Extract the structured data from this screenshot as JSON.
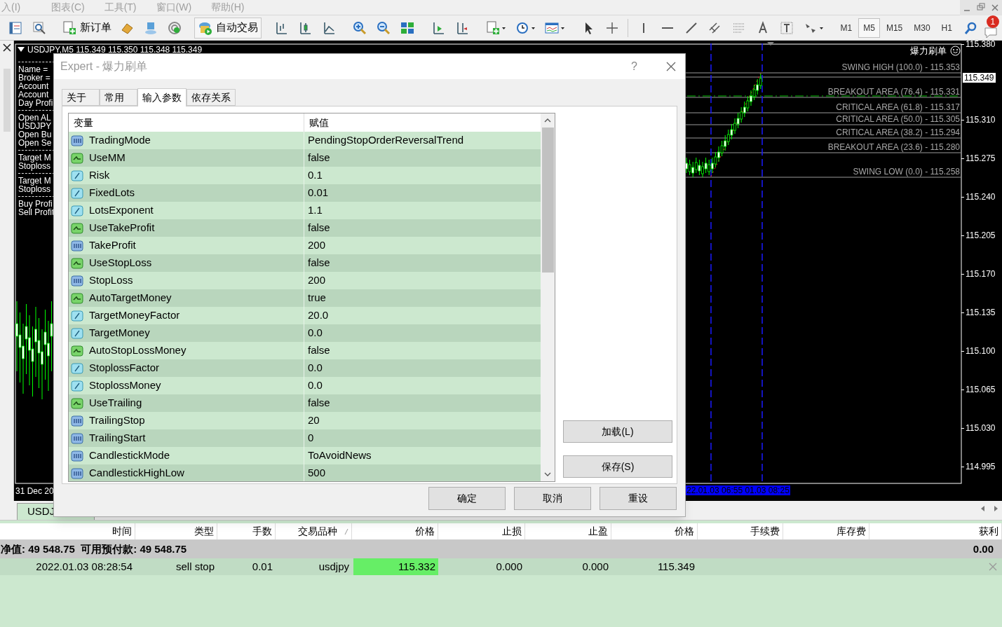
{
  "menu_bar": {
    "items": [
      "入(I)",
      "图表(C)",
      "工具(T)",
      "窗口(W)",
      "帮助(H)"
    ]
  },
  "toolbar": {
    "buttons": [
      {
        "kind": "new_order",
        "label": "新订单"
      },
      {
        "kind": "autotrading",
        "label": "自动交易"
      }
    ],
    "timeframes": [
      {
        "label": "M1",
        "selected": false
      },
      {
        "label": "M5",
        "selected": true
      },
      {
        "label": "M15",
        "selected": false
      },
      {
        "label": "M30",
        "selected": false
      },
      {
        "label": "H1",
        "selected": false
      }
    ],
    "notification_count": "1"
  },
  "chart": {
    "title": "USDJPY,M5  115.349 115.350 115.348 115.349",
    "indicator_name": "爆力刷单",
    "info_groups": [
      [
        "Name =",
        "Broker =",
        "Account",
        "Account",
        "Day Profi"
      ],
      [
        "Open AL",
        "USDJPY",
        "Open Bu",
        "Open Se"
      ],
      [
        "Target M",
        "Stoploss"
      ],
      [
        "Target M",
        "Stoploss"
      ],
      [
        "Buy Profi",
        "Sell Profit"
      ]
    ],
    "fib_levels": [
      "SWING HIGH (100.0) - 115.353",
      "BREAKOUT AREA (76.4) -  115.331",
      "CRITICAL AREA (61.8) -  115.317",
      "CRITICAL AREA (50.0) -  115.305",
      "CRITICAL AREA (38.2) -  115.294",
      "BREAKOUT AREA (23.6) -  115.280",
      "SWING LOW (0.0) - 115.258"
    ],
    "price_axis": [
      "115.380",
      "115.310",
      "115.275",
      "115.240",
      "115.205",
      "115.170",
      "115.135",
      "115.100",
      "115.065",
      "115.030",
      "114.995"
    ],
    "current_price": "115.349",
    "time_start": "31 Dec 20",
    "time_selected": "22.01.03 06:55 01.03 08:25"
  },
  "chart_tabs": [
    {
      "label": "USDJ",
      "selected": true
    }
  ],
  "dialog": {
    "title": "Expert - 爆力刷单",
    "help": "?",
    "tabs": [
      {
        "label": "关于",
        "selected": false
      },
      {
        "label": "常用",
        "selected": false
      },
      {
        "label": "输入参数",
        "selected": true
      },
      {
        "label": "依存关系",
        "selected": false
      }
    ],
    "columns": [
      "变量",
      "赋值"
    ],
    "rows": [
      {
        "kind": "int",
        "name": "TradingMode",
        "value": "PendingStopOrderReversalTrend"
      },
      {
        "kind": "bool",
        "name": "UseMM",
        "value": "false"
      },
      {
        "kind": "double",
        "name": "Risk",
        "value": "0.1"
      },
      {
        "kind": "double",
        "name": "FixedLots",
        "value": "0.01"
      },
      {
        "kind": "double",
        "name": "LotsExponent",
        "value": "1.1"
      },
      {
        "kind": "bool",
        "name": "UseTakeProfit",
        "value": "false"
      },
      {
        "kind": "int",
        "name": "TakeProfit",
        "value": "200"
      },
      {
        "kind": "bool",
        "name": "UseStopLoss",
        "value": "false"
      },
      {
        "kind": "int",
        "name": "StopLoss",
        "value": "200"
      },
      {
        "kind": "bool",
        "name": "AutoTargetMoney",
        "value": "true"
      },
      {
        "kind": "double",
        "name": "TargetMoneyFactor",
        "value": "20.0"
      },
      {
        "kind": "double",
        "name": "TargetMoney",
        "value": "0.0"
      },
      {
        "kind": "bool",
        "name": "AutoStopLossMoney",
        "value": "false"
      },
      {
        "kind": "double",
        "name": "StoplossFactor",
        "value": "0.0"
      },
      {
        "kind": "double",
        "name": "StoplossMoney",
        "value": "0.0"
      },
      {
        "kind": "bool",
        "name": "UseTrailing",
        "value": "false"
      },
      {
        "kind": "int",
        "name": "TrailingStop",
        "value": "20"
      },
      {
        "kind": "int",
        "name": "TrailingStart",
        "value": "0"
      },
      {
        "kind": "int",
        "name": "CandlestickMode",
        "value": "ToAvoidNews"
      },
      {
        "kind": "int",
        "name": "CandlestickHighLow",
        "value": "500"
      }
    ],
    "side_buttons": [
      "加载(L)",
      "保存(S)"
    ],
    "buttons": [
      "确定",
      "取消",
      "重设"
    ]
  },
  "terminal": {
    "columns": [
      "时间",
      "类型",
      "手数",
      "交易品种",
      "价格",
      "止损",
      "止盈",
      "价格",
      "手续费",
      "库存费",
      "获利"
    ],
    "balance": "净值: 49 548.75  可用预付款: 49 548.75",
    "balance_profit": "0.00",
    "orders": [
      {
        "cells": [
          "2022.01.03 08:28:54",
          "sell stop",
          "0.01",
          "usdjpy",
          "115.332",
          "0.000",
          "0.000",
          "115.349"
        ],
        "price_highlighted": true
      }
    ]
  }
}
